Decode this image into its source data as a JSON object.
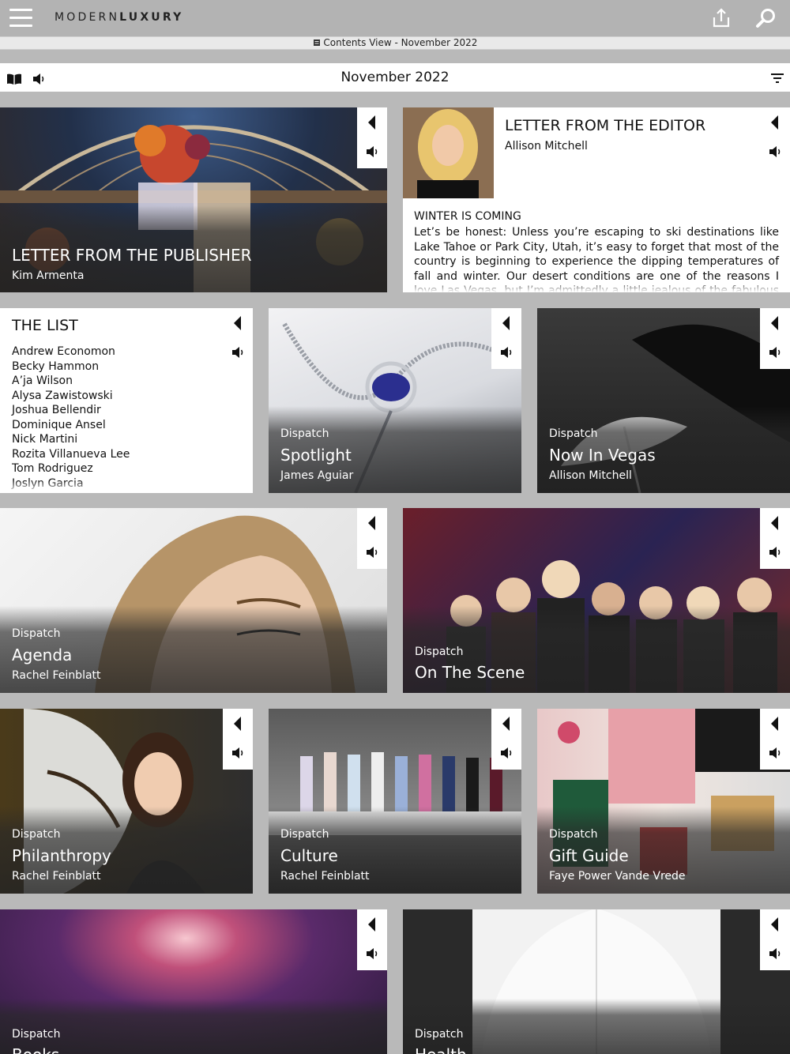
{
  "app": {
    "brand_light": "MODERN",
    "brand_bold": "LUXURY",
    "view_label": "Contents View - November 2022",
    "issue_title": "November 2022",
    "icons": [
      "menu-icon",
      "share-icon",
      "search-icon",
      "book-icon",
      "speaker-icon",
      "filter-icon"
    ]
  },
  "colors": {
    "topbar": "#b3b3b3",
    "background": "#b9b9b9",
    "panel": "#ffffff"
  },
  "cards": {
    "publisher": {
      "title": "LETTER FROM THE PUBLISHER",
      "author": "Kim Armenta"
    },
    "editor": {
      "title": "LETTER FROM THE EDITOR",
      "author": "Allison Mitchell",
      "heading": "WINTER IS COMING",
      "body": "Let’s be honest: Unless you’re escaping to ski destinations like Lake Tahoe or Park City, Utah, it’s easy to forget that most of the country is beginning to experience the dipping temperatures of fall and winter. Our desert conditions are one of the reasons I love Las Vegas, but I’m admittedly a little jealous of the fabulous coats"
    },
    "the_list": {
      "title": "THE LIST",
      "names": [
        "Andrew Economon",
        "Becky Hammon",
        "A’ja Wilson",
        "Alysa Zawistowski",
        "Joshua Bellendir",
        "Dominique Ansel",
        "Nick Martini",
        "Rozita Villanueva Lee",
        "Tom Rodriguez",
        "Joslyn Garcia"
      ]
    },
    "spotlight": {
      "category": "Dispatch",
      "title": "Spotlight",
      "author": "James Aguiar"
    },
    "now_in_vegas": {
      "category": "Dispatch",
      "title": "Now In Vegas",
      "author": "Allison Mitchell"
    },
    "agenda": {
      "category": "Dispatch",
      "title": "Agenda",
      "author": "Rachel Feinblatt"
    },
    "on_the_scene": {
      "category": "Dispatch",
      "title": "On The Scene"
    },
    "philanthropy": {
      "category": "Dispatch",
      "title": "Philanthropy",
      "author": "Rachel Feinblatt"
    },
    "culture": {
      "category": "Dispatch",
      "title": "Culture",
      "author": "Rachel Feinblatt"
    },
    "gift_guide": {
      "category": "Dispatch",
      "title": "Gift Guide",
      "author": "Faye Power Vande Vrede"
    },
    "books": {
      "category": "Dispatch",
      "title": "Books"
    },
    "health": {
      "category": "Dispatch",
      "title": "Health"
    }
  }
}
